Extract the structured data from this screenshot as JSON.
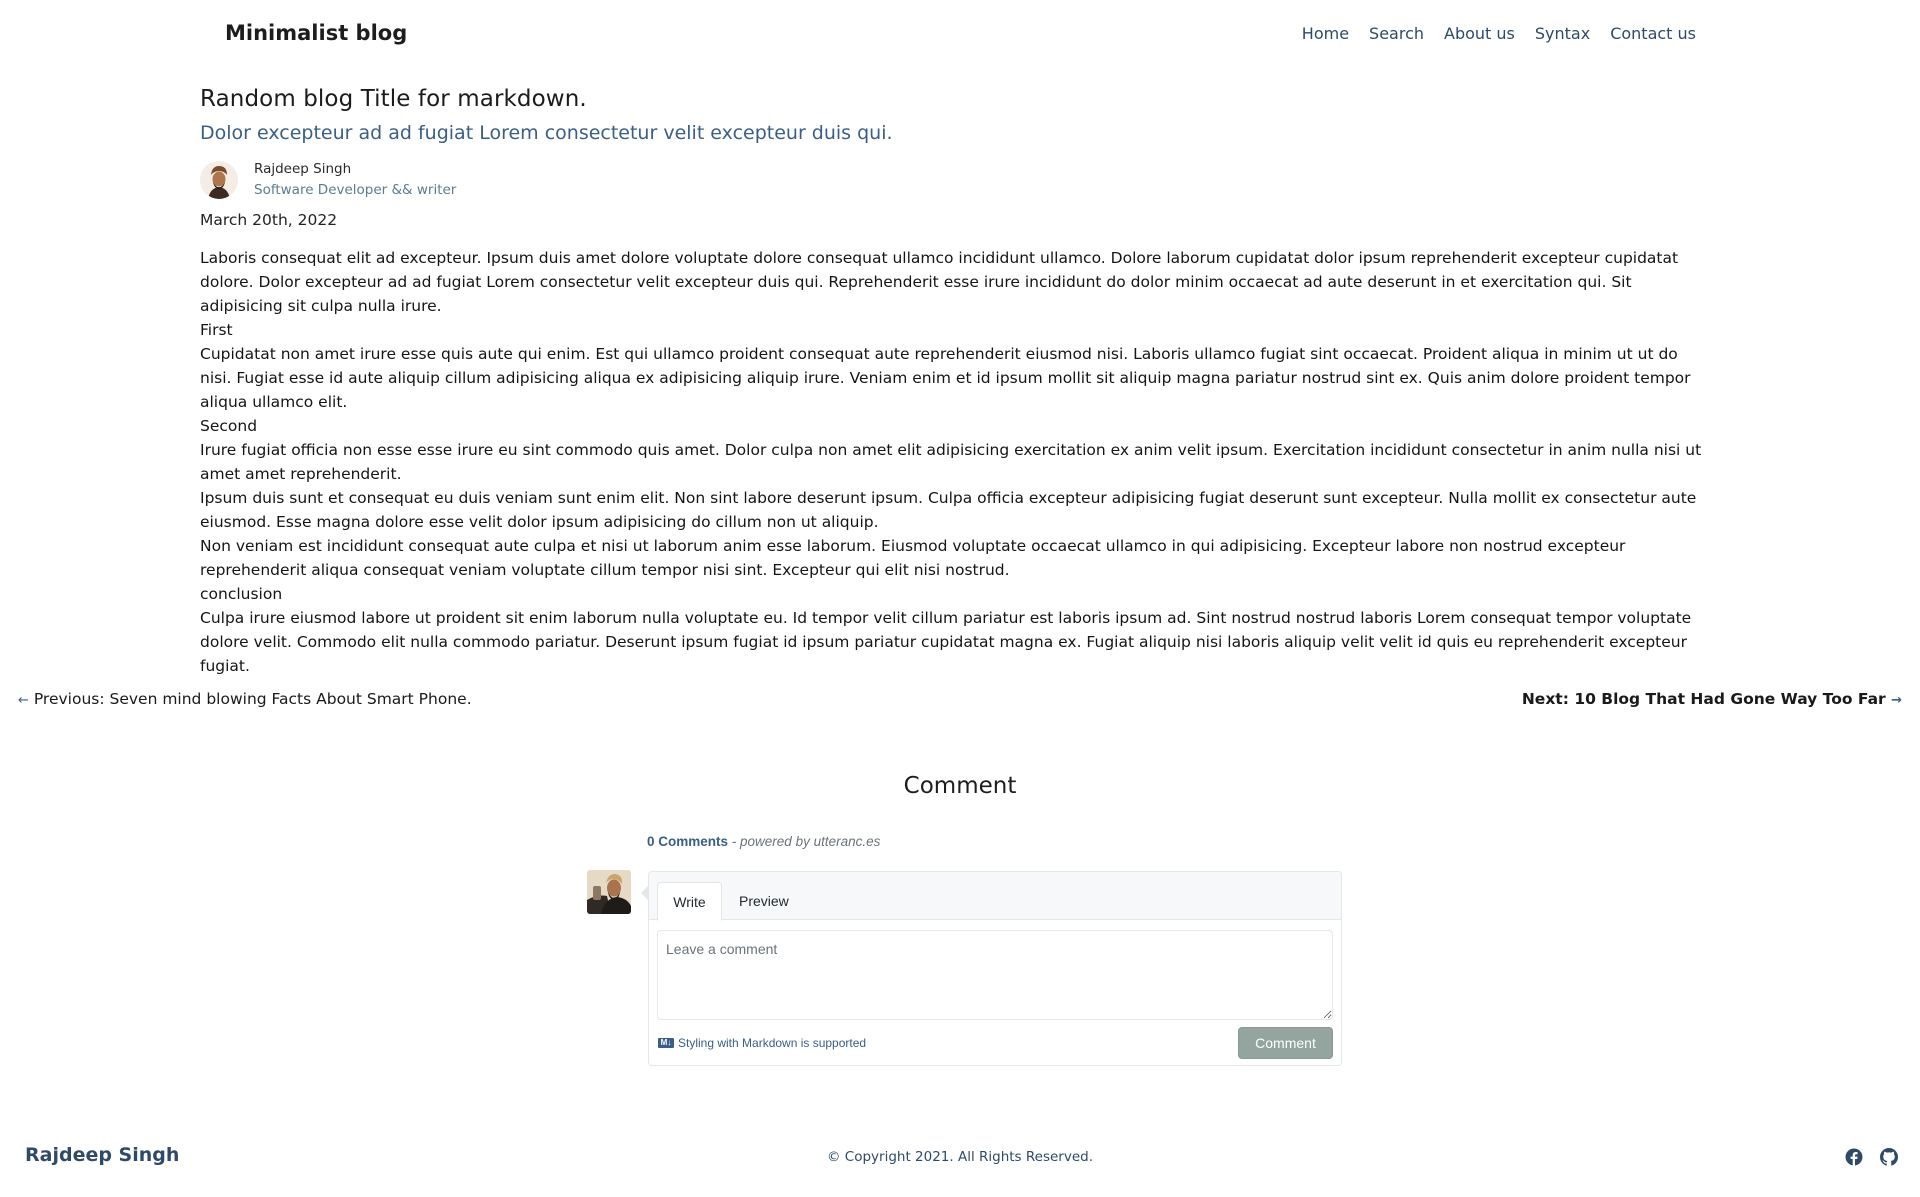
{
  "header": {
    "brand": "Minimalist blog",
    "nav": [
      "Home",
      "Search",
      "About us",
      "Syntax",
      "Contact us"
    ]
  },
  "post": {
    "title": "Random blog Title for markdown.",
    "subtitle": "Dolor excepteur ad ad fugiat Lorem consectetur velit excepteur duis qui.",
    "author_name": "Rajdeep Singh",
    "author_role": "Software Developer && writer",
    "date": "March 20th, 2022",
    "body": [
      "Laboris consequat elit ad excepteur. Ipsum duis amet dolore voluptate dolore consequat ullamco incididunt ullamco. Dolore laborum cupidatat dolor ipsum reprehenderit excepteur cupidatat dolore. Dolor excepteur ad ad fugiat Lorem consectetur velit excepteur duis qui. Reprehenderit esse irure incididunt do dolor minim occaecat ad aute deserunt in et exercitation qui. Sit adipisicing sit culpa nulla irure.",
      "First",
      "Cupidatat non amet irure esse quis aute qui enim. Est qui ullamco proident consequat aute reprehenderit eiusmod nisi. Laboris ullamco fugiat sint occaecat. Proident aliqua in minim ut ut do nisi. Fugiat esse id aute aliquip cillum adipisicing aliqua ex adipisicing aliquip irure. Veniam enim et id ipsum mollit sit aliquip magna pariatur nostrud sint ex. Quis anim dolore proident tempor aliqua ullamco elit.",
      "Second",
      "Irure fugiat officia non esse esse irure eu sint commodo quis amet. Dolor culpa non amet elit adipisicing exercitation ex anim velit ipsum. Exercitation incididunt consectetur in anim nulla nisi ut amet amet reprehenderit.",
      "Ipsum duis sunt et consequat eu duis veniam sunt enim elit. Non sint labore deserunt ipsum. Culpa officia excepteur adipisicing fugiat deserunt sunt excepteur. Nulla mollit ex consectetur aute eiusmod. Esse magna dolore esse velit dolor ipsum adipisicing do cillum non ut aliquip.",
      "Non veniam est incididunt consequat aute culpa et nisi ut laborum anim esse laborum. Eiusmod voluptate occaecat ullamco in qui adipisicing. Excepteur labore non nostrud excepteur reprehenderit aliqua consequat veniam voluptate cillum tempor nisi sint. Excepteur qui elit nisi nostrud.",
      "conclusion",
      "Culpa irure eiusmod labore ut proident sit enim laborum nulla voluptate eu. Id tempor velit cillum pariatur est laboris ipsum ad. Sint nostrud nostrud laboris Lorem consequat tempor voluptate dolore velit. Commodo elit nulla commodo pariatur. Deserunt ipsum fugiat id ipsum pariatur cupidatat magna ex. Fugiat aliquip nisi laboris aliquip velit velit id quis eu reprehenderit excepteur fugiat."
    ]
  },
  "post_nav": {
    "prev_arrow": "←",
    "prev_label": "Previous: Seven mind blowing Facts About Smart Phone.",
    "next_label": "Next: 10 Blog That Had Gone Way Too Far",
    "next_arrow": "→"
  },
  "comments": {
    "heading": "Comment",
    "count": "0 Comments",
    "powered_by": " - powered by utteranc.es",
    "tab_write": "Write",
    "tab_preview": "Preview",
    "placeholder": "Leave a comment",
    "markdown_icon": "M↓",
    "markdown_note": "Styling with Markdown is supported",
    "submit_label": "Comment"
  },
  "footer": {
    "name": "Rajdeep Singh",
    "copyright": "© Copyright 2021. All Rights Reserved.",
    "icons": [
      "facebook-icon",
      "github-icon"
    ]
  },
  "colors": {
    "accent": "#3a5e86",
    "nav_link": "#2f4a68",
    "button_disabled": "#94a59f"
  }
}
